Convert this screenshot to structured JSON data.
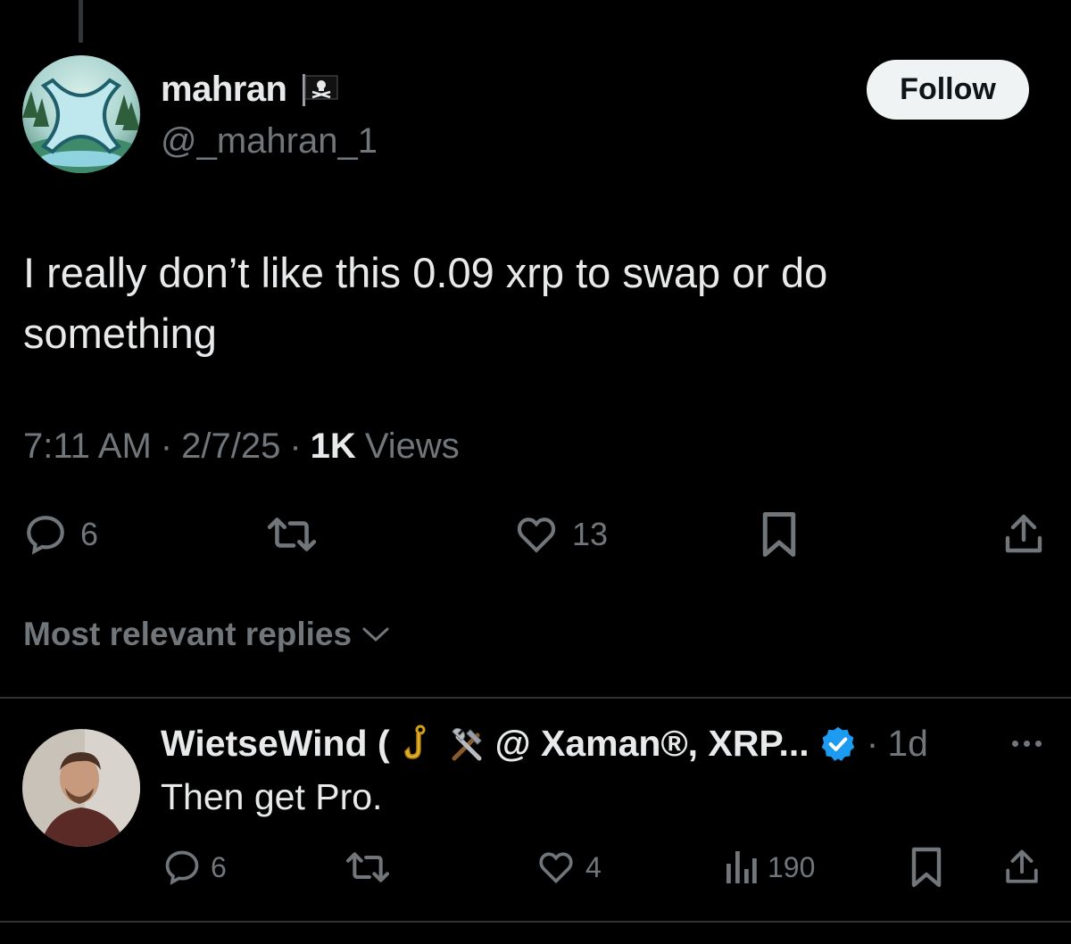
{
  "main_tweet": {
    "author": {
      "display_name": "mahran",
      "handle": "@_mahran_1",
      "badge_icon": "pirate-flag-icon"
    },
    "follow_label": "Follow",
    "text": "I really don’t like this 0.09 xrp to swap or do something",
    "time": "7:11 AM",
    "separator": "·",
    "date": "2/7/25",
    "views_count": "1K",
    "views_label": "Views",
    "stats": {
      "replies": "6",
      "likes": "13"
    }
  },
  "replies_sort": {
    "label": "Most relevant replies"
  },
  "reply": {
    "display_name_start": "WietseWind (",
    "display_name_end": "@ Xaman®, XRP...",
    "emoji_1": "hook-emoji",
    "emoji_2": "hammer-and-wrench-emoji",
    "verified_icon": "verified-badge-icon",
    "time_sep": "·",
    "time": "1d",
    "text": "Then get Pro.",
    "stats": {
      "replies": "6",
      "likes": "4",
      "views": "190"
    }
  },
  "colors": {
    "background": "#000000",
    "text": "#e7e9ea",
    "muted": "#71767b",
    "verified": "#1d9bf0",
    "follow_bg": "#eff3f4"
  }
}
